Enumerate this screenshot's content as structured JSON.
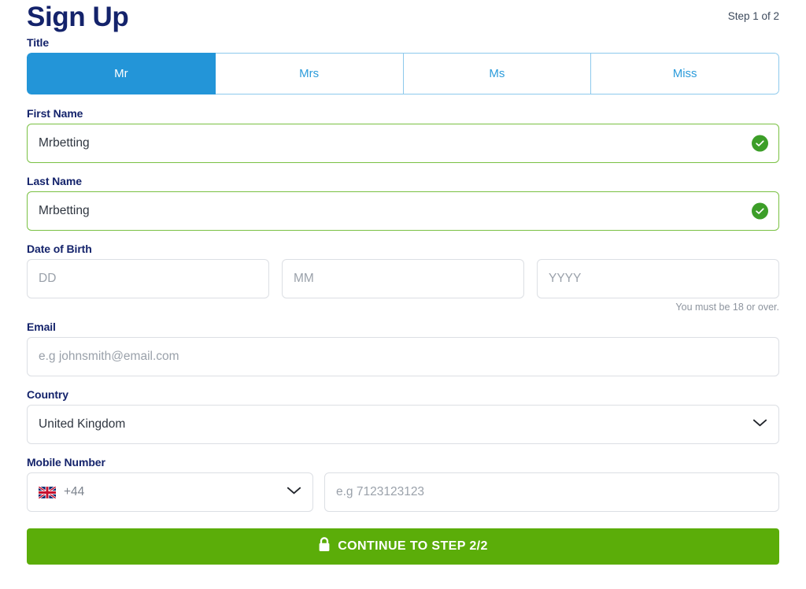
{
  "header": {
    "title": "Sign Up",
    "step_indicator": "Step 1 of 2"
  },
  "title_field": {
    "label": "Title",
    "options": [
      {
        "label": "Mr",
        "selected": true
      },
      {
        "label": "Mrs",
        "selected": false
      },
      {
        "label": "Ms",
        "selected": false
      },
      {
        "label": "Miss",
        "selected": false
      }
    ]
  },
  "first_name": {
    "label": "First Name",
    "value": "Mrbetting",
    "placeholder": "",
    "valid": true,
    "icon": "check-circle-icon"
  },
  "last_name": {
    "label": "Last Name",
    "value": "Mrbetting",
    "placeholder": "",
    "valid": true,
    "icon": "check-circle-icon"
  },
  "date_of_birth": {
    "label": "Date of Birth",
    "day_placeholder": "DD",
    "month_placeholder": "MM",
    "year_placeholder": "YYYY",
    "day_value": "",
    "month_value": "",
    "year_value": "",
    "helper_text": "You must be 18 or over."
  },
  "email": {
    "label": "Email",
    "placeholder": "e.g johnsmith@email.com",
    "value": ""
  },
  "country": {
    "label": "Country",
    "value": "United Kingdom",
    "icon": "chevron-down-icon"
  },
  "mobile": {
    "label": "Mobile Number",
    "dial_code": "+44",
    "flag": "uk-flag-icon",
    "dial_icon": "chevron-down-icon",
    "number_placeholder": "e.g 7123123123",
    "number_value": ""
  },
  "cta": {
    "label": "CONTINUE TO STEP 2/2",
    "icon": "padlock-icon"
  },
  "colors": {
    "brand_navy": "#14236b",
    "accent_blue": "#2395d8",
    "segment_border_blue": "#8dc9ec",
    "valid_green": "#7ac143",
    "check_green": "#3c9e28",
    "cta_green": "#5bad09",
    "input_border": "#dcdfe4",
    "placeholder_gray": "#9aa1aa"
  }
}
